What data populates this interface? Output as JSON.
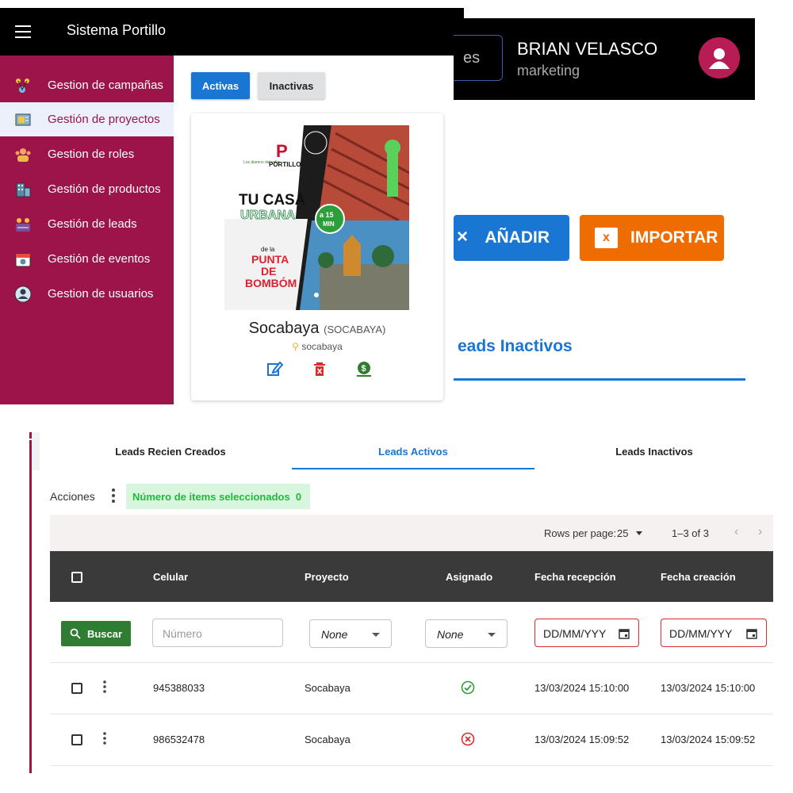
{
  "app": {
    "title": "Sistema Portillo"
  },
  "sidebar": {
    "items": [
      {
        "label": "Gestion de campañas",
        "icon": "campaign-icon",
        "active": false
      },
      {
        "label": "Gestión de proyectos",
        "icon": "blueprint-icon",
        "active": true
      },
      {
        "label": "Gestion de roles",
        "icon": "roles-icon",
        "active": false
      },
      {
        "label": "Gestión de productos",
        "icon": "building-icon",
        "active": false
      },
      {
        "label": "Gestión de leads",
        "icon": "leads-icon",
        "active": false
      },
      {
        "label": "Gestión de eventos",
        "icon": "calendar-icon",
        "active": false
      },
      {
        "label": "Gestion de usuarios",
        "icon": "user-icon",
        "active": false
      }
    ]
  },
  "projects": {
    "filter_tabs": {
      "active": "Activas",
      "inactive": "Inactivas"
    },
    "card": {
      "name": "Socabaya",
      "code": "(SOCABAYA)",
      "location": "socabaya",
      "image": {
        "brand_left": "Los álamos del valle",
        "brand_main": "PORTILLO",
        "brand_right": "Los álamos del valle",
        "headline_1": "TU CASA",
        "headline_2": "URBANA",
        "badge_top": "a 15",
        "badge_bottom": "MIN",
        "sub_1": "de la",
        "sub_2": "PUNTA",
        "sub_3": "DE",
        "sub_4": "BOMBÓM"
      },
      "actions": [
        "edit-icon",
        "delete-icon",
        "money-icon"
      ]
    }
  },
  "user_header": {
    "search_fragment": "es",
    "name": "BRIAN VELASCO",
    "role": "marketing"
  },
  "lead_actions": {
    "add_label": "AÑADIR",
    "import_label": "IMPORTAR",
    "import_icon_letter": "x",
    "tab_fragment": "eads Inactivos"
  },
  "leads": {
    "tabs": [
      "Leads Recien Creados",
      "Leads Activos",
      "Leads Inactivos"
    ],
    "active_tab": "Leads Activos",
    "toolbar": {
      "actions_label": "Acciones",
      "selected_label": "Número de items seleccionados",
      "selected_count": "0"
    },
    "pagination": {
      "rows_label": "Rows per page:",
      "rows_value": "25",
      "range": "1–3 of 3"
    },
    "columns": [
      "Celular",
      "Proyecto",
      "Asignado",
      "Fecha recepción",
      "Fecha creación"
    ],
    "filters": {
      "search_button": "Buscar",
      "numero_placeholder": "Número",
      "proyecto_value": "None",
      "asignado_value": "None",
      "date_placeholder_1": "DD/MM/YYY",
      "date_placeholder_2": "DD/MM/YYY"
    },
    "rows": [
      {
        "celular": "945388033",
        "proyecto": "Socabaya",
        "asignado": true,
        "fecha_recepcion": "13/03/2024 15:10:00",
        "fecha_creacion": "13/03/2024 15:10:00"
      },
      {
        "celular": "986532478",
        "proyecto": "Socabaya",
        "asignado": false,
        "fecha_recepcion": "13/03/2024 15:09:52",
        "fecha_creacion": "13/03/2024 15:09:52"
      }
    ]
  },
  "colors": {
    "sidebar": "#9c1449",
    "primary": "#1976d2",
    "import": "#ef6c00",
    "success": "#2e7d32",
    "error": "#d32f2f",
    "table_header": "#3a3a3a"
  }
}
